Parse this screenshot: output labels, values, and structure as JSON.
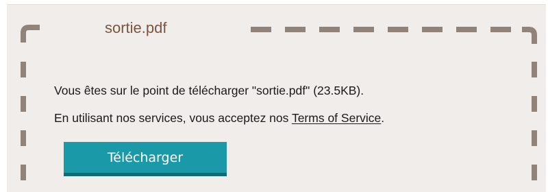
{
  "file": {
    "name": "sortie.pdf"
  },
  "message": {
    "line1": "Vous êtes sur le point de télécharger \"sortie.pdf\" (23.5KB).",
    "line2_prefix": "En utilisant nos services, vous acceptez nos ",
    "tos_link": "Terms of Service",
    "line2_suffix": "."
  },
  "actions": {
    "download_label": "Télécharger"
  },
  "colors": {
    "panel_background": "#f0edea",
    "dashed_border": "#8f837a",
    "title_text": "#7a5540",
    "button_background": "#1a9aa8",
    "button_shadow": "#0d6e78"
  }
}
